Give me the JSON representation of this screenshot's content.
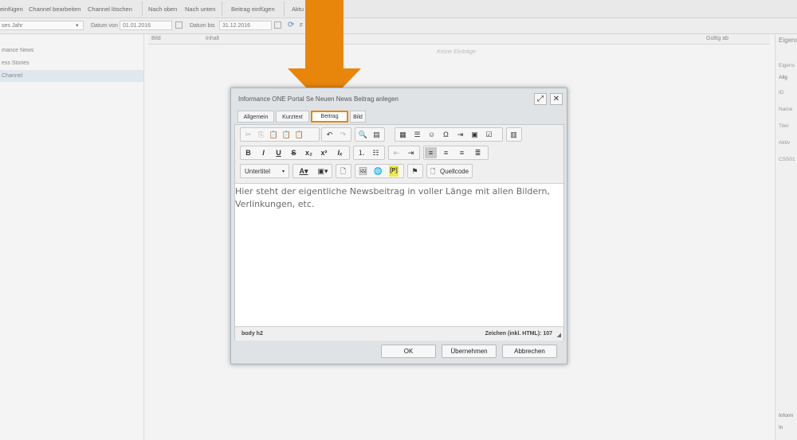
{
  "toolbar": {
    "items": [
      "einfügen",
      "Channel bearbeiten",
      "Channel löschen",
      "Nach oben",
      "Nach unten",
      "Beitrag einfügen",
      "Aktu"
    ]
  },
  "filter": {
    "year_select": "ses Jahr",
    "date_from_label": "Datum von",
    "date_from": "01.01.2016",
    "date_to_label": "Datum bis",
    "date_to": "31.12.2016",
    "extra": "F"
  },
  "channels": [
    "mance News",
    "ess Stories",
    "Channel"
  ],
  "grid": {
    "col_bild": "Bild",
    "col_inhalt": "Inhalt",
    "col_gueltig": "Gültig ab",
    "empty": "Keine Einträge"
  },
  "right_panel": {
    "title": "Eigens",
    "sub": "Eigens",
    "dropdown": "Allg",
    "fields": [
      "ID",
      "Name",
      "Titel",
      "Aktiv",
      "CSS01"
    ],
    "bottom": "Inform",
    "bottom_item": "In"
  },
  "dialog": {
    "title": "Informance ONE Portal Se    Neuen News Beitrag anlegen",
    "tabs": [
      "Allgemein",
      "Kurztext",
      "Beitrag",
      "Bild"
    ],
    "active_tab": "Beitrag",
    "style_select": "Untertitel",
    "source_button": "Quellcode",
    "content": "Hier steht der eigentliche Newsbeitrag in voller Länge mit allen Bildern, Verlinkungen, etc.",
    "path": "body   h2",
    "char_count": "Zeichen (inkl. HTML): 107",
    "buttons": {
      "ok": "OK",
      "apply": "Übernehmen",
      "cancel": "Abbrechen"
    }
  },
  "colors": {
    "accent": "#e8860c",
    "dialog_bg": "#dfe3e6"
  }
}
